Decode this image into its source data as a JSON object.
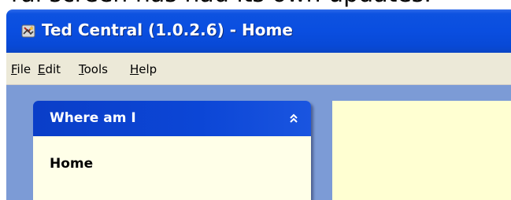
{
  "background_text": "ral screen has had its own updates.",
  "window": {
    "title": "Ted Central (1.0.2.6) - Home",
    "icon": "ted-app-icon"
  },
  "menubar": {
    "items": [
      {
        "accel": "F",
        "rest": "ile"
      },
      {
        "accel": "E",
        "rest": "dit"
      },
      {
        "accel": "T",
        "rest": "ools"
      },
      {
        "accel": "H",
        "rest": "elp"
      }
    ]
  },
  "panel": {
    "title": "Where am I",
    "collapse_icon": "chevron-double-up-icon",
    "item": "Home"
  },
  "colors": {
    "titlebar": "#0a4ee0",
    "menubar": "#ece9d8",
    "workspace": "#7c9bd6",
    "panel_header": "#0c46d6",
    "panel_body": "#ffffe8",
    "main_area": "#ffffd2"
  }
}
